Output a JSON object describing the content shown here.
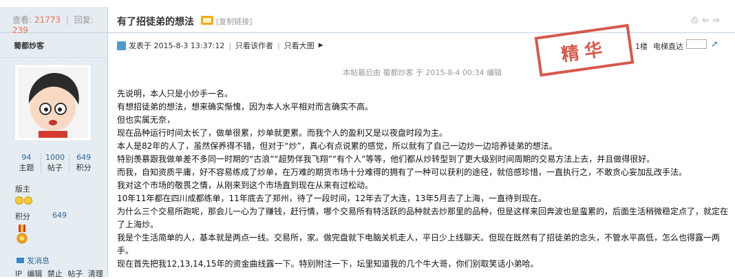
{
  "sidebar": {
    "views_label": "查看:",
    "views": "21773",
    "replies_label": "回复:",
    "replies": "239",
    "username": "蜀都炒客",
    "stats": [
      {
        "value": "94",
        "label": "主题"
      },
      {
        "value": "1000",
        "label": "帖子"
      },
      {
        "value": "649",
        "label": "积分"
      }
    ],
    "group": "版主",
    "points_label": "积分",
    "points_value": "649",
    "message": "发消息",
    "links": [
      "IP",
      "编辑",
      "禁止",
      "帖子",
      "清理"
    ]
  },
  "thread": {
    "title": "有了招徒弟的想法",
    "copy_link": "[复制链接]",
    "posted_at": "发表于 2015-8-3 13:37:12",
    "only_author": "只看该作者",
    "large_image": "只看大图",
    "floor": "1楼",
    "jump_label": "电梯直达",
    "stamp_text": "精华",
    "edited_note": "本帖最后由 蜀都炒客 于 2015-8-4 00:34 编辑",
    "body": [
      "先说明，本人只是小炒手一名。",
      "有想招徒弟的想法，想来确实惭愧，因为本人水平相对而言确实不高。",
      "但也实属无奈，",
      "现在品种运行时间太长了，做单很累，炒单就更累。而我个人的盈利又是以夜盘时段为主。",
      "本人是82年的人了，虽然保养得不错，但对于“炒”，真心有点说累的感觉，所以就有了自己一边炒一边培养徒弟的想法。",
      "特别羡慕跟我做单差不多同一时期的“古浪”“超势伴我飞翔”“有个人”等等，他们都从炒转型到了更大级别时间周期的交易方法上去，并且做得很好。",
      "而我，自知资质平庸，好不容易练成了炒单，在万难的期货市场十分难得的拥有了一种可以获利的途径，就倍感珍惜，一直执行之，不敢贪心妄加乱改手法。",
      "我对这个市场的敬畏之情，从刚来到这个市场直到现在从来有过松动。",
      "10年11年都在四川成都练单，11年底去了郑州，待了一段时间，12年去了大连，13年5月去了上海，一直待到现在。",
      "为什么三个交易所跑呢，那会儿一心为了赚钱，赶行情，哪个交易所有特活跃的品种就去炒那里的品种，但是这样来回奔波也是蛮累的，后面生活稍微稳定点了，就定在了上海炒。",
      "我是个生活简单的人，基本就是两点一线。交易所，家。做完盘就下电脑关机走人，平日少上线聊天。但现在既然有了招徒弟的念头，不管水平高低，怎么也得露一两手。",
      "现在首先把我12,13,14,15年的资金曲线露一下。特别附注一下，坛里知道我的几个牛大哥，你们别取笑话小弟哈。"
    ]
  },
  "colors": {
    "sidebar_bg": "#e5edf2",
    "border": "#c2d5e3",
    "accent_red": "#f26c4f",
    "link_blue": "#336699",
    "stamp_red": "#d13b2b"
  }
}
